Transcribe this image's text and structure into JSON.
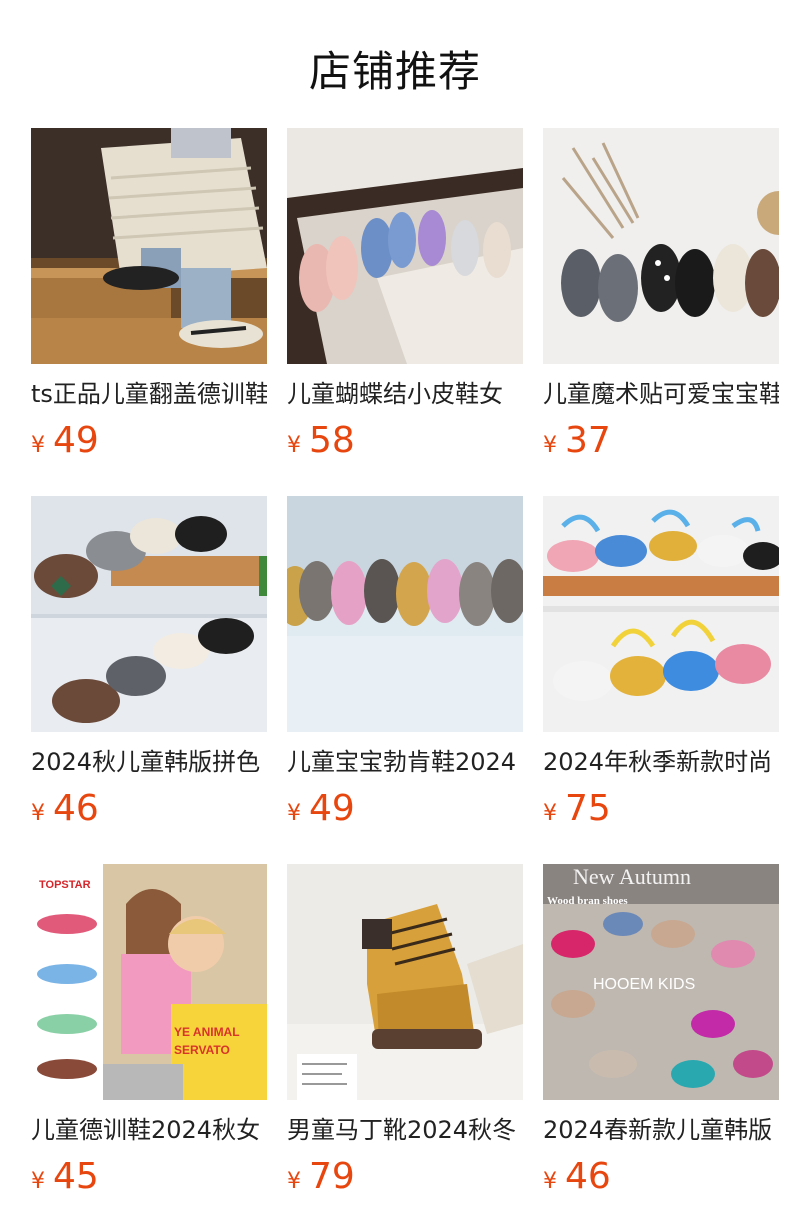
{
  "page": {
    "title": "店铺推荐"
  },
  "products": [
    {
      "name": "ts正品儿童翻盖德训鞋",
      "currency": "¥",
      "price": "49"
    },
    {
      "name": "儿童蝴蝶结小皮鞋女",
      "currency": "¥",
      "price": "58"
    },
    {
      "name": "儿童魔术贴可爱宝宝鞋",
      "currency": "¥",
      "price": "37"
    },
    {
      "name": "2024秋儿童韩版拼色",
      "currency": "¥",
      "price": "46"
    },
    {
      "name": "儿童宝宝勃肯鞋2024",
      "currency": "¥",
      "price": "49"
    },
    {
      "name": "2024年秋季新款时尚",
      "currency": "¥",
      "price": "75"
    },
    {
      "name": "儿童德训鞋2024秋女",
      "currency": "¥",
      "price": "45"
    },
    {
      "name": "男童马丁靴2024秋冬",
      "currency": "¥",
      "price": "79"
    },
    {
      "name": "2024春新款儿童韩版",
      "currency": "¥",
      "price": "46"
    }
  ],
  "image_text": {
    "brand_logo": "TOPSTAR",
    "sweater_text_1": "YE ANIMAL",
    "sweater_text_2": "SERVATO",
    "magazine_heading": "New Autumn",
    "magazine_subheading": "Wood bran shoes",
    "magazine_brand": "HOOEM   KIDS"
  },
  "colors": {
    "price": "#e8460f",
    "title": "#111111",
    "name": "#222222"
  }
}
